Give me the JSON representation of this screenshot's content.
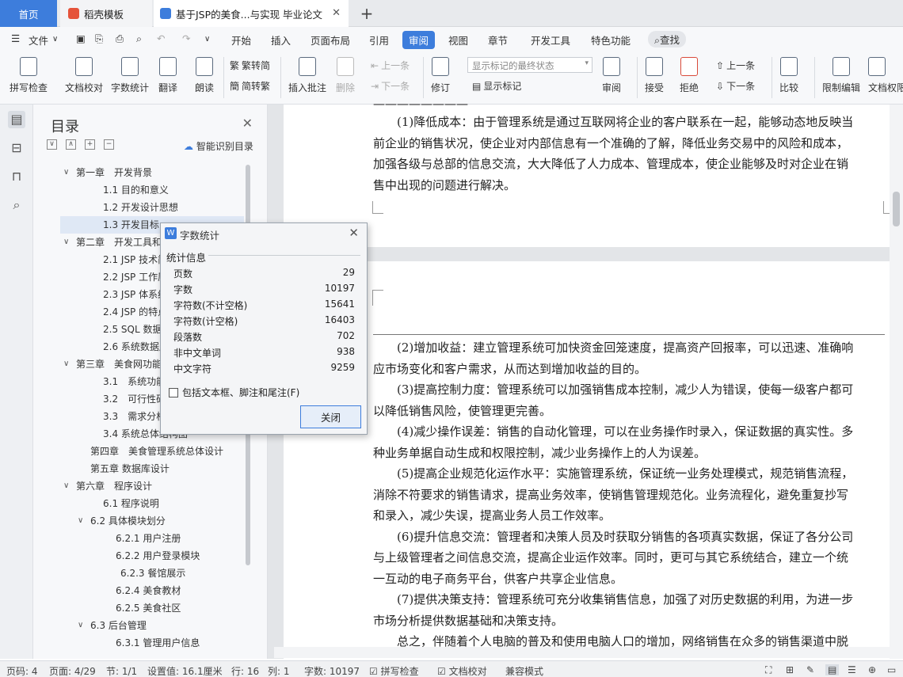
{
  "tabs": {
    "home": "首页",
    "template": "稻壳模板",
    "doc": "基于JSP的美食...与实现 毕业论文"
  },
  "menu": {
    "file": "文件",
    "items": [
      "开始",
      "插入",
      "页面布局",
      "引用",
      "审阅",
      "视图",
      "章节",
      "开发工具",
      "特色功能"
    ],
    "search": "查找",
    "active": "审阅"
  },
  "ribbon": {
    "buttons": [
      "拼写检查",
      "文档校对",
      "字数统计",
      "翻译",
      "朗读"
    ],
    "convert": [
      "繁转简",
      "简转繁"
    ],
    "comment": [
      "插入批注",
      "删除"
    ],
    "nav": [
      "上一条",
      "下一条"
    ],
    "revise": "修订",
    "markup_dropdown": "显示标记的最终状态",
    "show_markup": "显示标记",
    "review": "审阅",
    "accept": "接受",
    "reject": "拒绝",
    "prev_change": "上一条",
    "next_change": "下一条",
    "compare": "比较",
    "restrict": "限制编辑",
    "permission": "文档权限"
  },
  "toc": {
    "title": "目录",
    "smart": "智能识别目录",
    "items": [
      "第一章　开发背景",
      "1.1 目的和意义",
      "1.2 开发设计思想",
      "1.3 开发目标",
      "第二章　开发工具和环",
      "2.1 JSP 技术简介",
      "2.2 JSP 工作原理",
      "2.3 JSP 体系结构",
      "2.4 JSP 的特点",
      "2.5 SQL 数据库",
      "2.6 系统数据库连接",
      "第三章　美食网功能分",
      "3.1　系统功能分析",
      "3.2　可行性研究",
      "3.3　需求分析",
      "3.4 系统总体结构图",
      "第四章　美食管理系统总体设计",
      "第五章 数据库设计",
      "第六章　程序设计",
      "6.1 程序说明",
      "6.2 具体模块划分",
      "6.2.1 用户注册",
      "6.2.2 用户登录模块",
      "6.2.3 餐馆展示",
      "6.2.4 美食教材",
      "6.2.5 美食社区",
      "6.3 后台管理",
      "6.3.1 管理用户信息"
    ]
  },
  "document": {
    "page1": [
      "(1)降低成本：由于管理系统是通过互联网将企业的客户联系在一起，能够动态地反映当",
      "前企业的销售状况，使企业对内部信息有一个准确的了解，降低业务交易中的风险和成本，",
      "加强各级与总部的信息交流，大大降低了人力成本、管理成本，使企业能够及时对企业在销",
      "售中出现的问题进行解决。"
    ],
    "page2": [
      "(2)增加收益：建立管理系统可加快资金回笼速度，提高资产回报率，可以迅速、准确响",
      "应市场变化和客户需求，从而达到增加收益的目的。",
      "(3)提高控制力度：管理系统可以加强销售成本控制，减少人为错误，使每一级客户都可",
      "以降低销售风险，使管理更完善。",
      "(4)减少操作误差：销售的自动化管理，可以在业务操作时录入，保证数据的真实性。多",
      "种业务单据自动生成和权限控制，减少业务操作上的人为误差。",
      "(5)提高企业规范化运作水平：实施管理系统，保证统一业务处理模式，规范销售流程，",
      "消除不符要求的销售请求，提高业务效率，使销售管理规范化。业务流程化，避免重复抄写",
      "和录入，减少失误，提高业务人员工作效率。",
      "(6)提升信息交流：管理者和决策人员及时获取分销售的各项真实数据，保证了各分公司",
      "与上级管理者之间信息交流，提高企业运作效率。同时，更可与其它系统结合，建立一个统",
      "一互动的电子商务平台，供客户共享企业信息。",
      "(7)提供决策支持：管理系统可充分收集销售信息，加强了对历史数据的利用，为进一步",
      "市场分析提供数据基础和决策支持。",
      "总之，伴随着个人电脑的普及和使用电脑人口的增加，网络销售在众多的销售渠道中脱"
    ]
  },
  "dialog": {
    "title": "字数统计",
    "section": "统计信息",
    "stats": [
      {
        "label": "页数",
        "value": "29"
      },
      {
        "label": "字数",
        "value": "10197"
      },
      {
        "label": "字符数(不计空格)",
        "value": "15641"
      },
      {
        "label": "字符数(计空格)",
        "value": "16403"
      },
      {
        "label": "段落数",
        "value": "702"
      },
      {
        "label": "非中文单词",
        "value": "938"
      },
      {
        "label": "中文字符",
        "value": "9259"
      }
    ],
    "checkbox": "包括文本框、脚注和尾注(F)",
    "close": "关闭"
  },
  "status": {
    "page": "页码: 4",
    "pages": "页面: 4/29",
    "section": "节: 1/1",
    "setting": "设置值: 16.1厘米",
    "row": "行: 16",
    "col": "列: 1",
    "words": "字数: 10197",
    "spell": "拼写检查",
    "proof": "文档校对",
    "compat": "兼容模式"
  },
  "colors": {
    "accent": "#3d7ddc",
    "highlight": "#dfe8f5"
  }
}
